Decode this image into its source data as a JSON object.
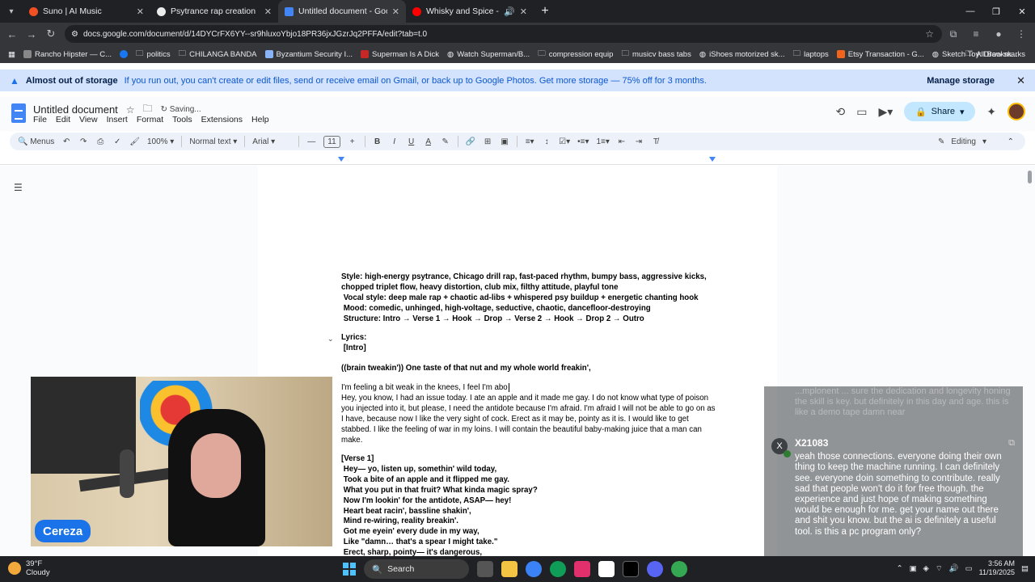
{
  "browser": {
    "tabs": [
      {
        "title": "Suno | AI Music",
        "active": false,
        "favicon_color": "#f25022"
      },
      {
        "title": "Psytrance rap creation",
        "active": false,
        "favicon_color": "#ffffff"
      },
      {
        "title": "Untitled document - Google Do",
        "active": true,
        "favicon_color": "#4285f4"
      },
      {
        "title": "Whisky and Spice - YouTub",
        "active": false,
        "favicon_color": "#ff0000"
      }
    ],
    "url": "docs.google.com/document/d/14DYCrFX6YY--sr9hluxoYbjo18PR36jxJGzrJq2PFFA/edit?tab=t.0",
    "bookmarks": [
      {
        "label": "Rancho Hipster — C...",
        "color": "#888888"
      },
      {
        "label": "",
        "color": "#1877f2"
      },
      {
        "label": "politics",
        "color": "#bdc1c6"
      },
      {
        "label": "CHILANGA BANDA",
        "color": "#bdc1c6"
      },
      {
        "label": "Byzantium Security I...",
        "color": "#8ab4f8"
      },
      {
        "label": "Superman Is A Dick",
        "color": "#c62828"
      },
      {
        "label": "Watch Superman/B...",
        "color": "#e8eaed"
      },
      {
        "label": "compression equip",
        "color": "#bdc1c6"
      },
      {
        "label": "musicv bass tabs",
        "color": "#bdc1c6"
      },
      {
        "label": "iShoes motorized sk...",
        "color": "#e8eaed"
      },
      {
        "label": "laptops",
        "color": "#bdc1c6"
      },
      {
        "label": "Etsy Transaction - G...",
        "color": "#f1641e"
      },
      {
        "label": "Sketch Toy: Draw sk...",
        "color": "#e8eaed"
      }
    ],
    "all_bookmarks": "All Bookmarks"
  },
  "banner": {
    "title": "Almost out of storage",
    "message": "If you run out, you can't create or edit files, send or receive email on Gmail, or back up to Google Photos. Get more storage — 75% off for 3 months.",
    "action": "Manage storage"
  },
  "docs": {
    "title": "Untitled document",
    "status": "Saving...",
    "menu": [
      "File",
      "Edit",
      "View",
      "Insert",
      "Format",
      "Tools",
      "Extensions",
      "Help"
    ],
    "share": "Share",
    "toolbar": {
      "menus": "Menus",
      "zoom": "100%",
      "style": "Normal text",
      "font": "Arial",
      "font_size": "11",
      "mode": "Editing"
    }
  },
  "document": {
    "style_lines": [
      "Style: high-energy psytrance, Chicago drill rap, fast-paced rhythm, bumpy bass, aggressive kicks,",
      "chopped triplet flow, heavy distortion, club mix, filthy attitude, playful tone",
      " Vocal style: deep male rap + chaotic ad-libs + whispered psy buildup + energetic chanting hook",
      " Mood: comedic, unhinged, high-voltage, seductive, chaotic, dancefloor-destroying",
      " Structure: Intro → Verse 1 → Hook → Drop → Verse 2 → Hook → Drop 2 → Outro"
    ],
    "lyrics_label": "Lyrics:",
    "intro_label": " [Intro]",
    "intro_line": "((brain tweakin')) One taste of that nut and my whole world freakin',",
    "typing_line": "I'm feeling a bit weak in the knees, I feel I'm abo",
    "paragraph": "Hey, you know, I had an issue today. I ate an apple and it made me gay. I do not know what type of poison you injected into it, but please, I need the antidote because I'm afraid. I'm afraid I will not be able to go on as I have, because now I like the very sight of cock. Erect as it may be, pointy as it is. I would like to get stabbed. I like the feeling of war in my loins. I will contain the beautiful baby-making juice that a man can make.",
    "verse_label": "[Verse 1]",
    "verse_lines": [
      " Hey— yo, listen up, somethin' wild today,",
      " Took a bite of an apple and it flipped me gay.",
      " What you put in that fruit? What kinda magic spray?",
      " Now I'm lookin' for the antidote, ASAP— hey!",
      " Heart beat racin', bassline shakin',",
      " Mind re-wiring, reality breakin'.",
      " Got me eyein' every dude in my way,",
      " Like \"damn… that's a spear I might take.\"",
      " Erect, sharp, pointy— it's dangerous,"
    ]
  },
  "webcam": {
    "name": "Cereza"
  },
  "chat": {
    "faded_text": "...mplonent ... sure the dedication and longevity honing the skill is key. but definitely in this day and age. this is like a demo tape damn near",
    "avatar_letter": "X",
    "username": "X21083",
    "message": "yeah those connections. everyone doing their own thing to keep the machine running. I can definitely see. everyone doin something to contribute. really sad that people won't do it for free though. the experience and just hope of making something would be enough for me. get your name out there and shit you know. but the ai is definitely a useful tool. is this a pc program only?"
  },
  "taskbar": {
    "temp": "39°F",
    "condition": "Cloudy",
    "search": "Search",
    "time": "3:56 AM",
    "date": "11/19/2025"
  }
}
